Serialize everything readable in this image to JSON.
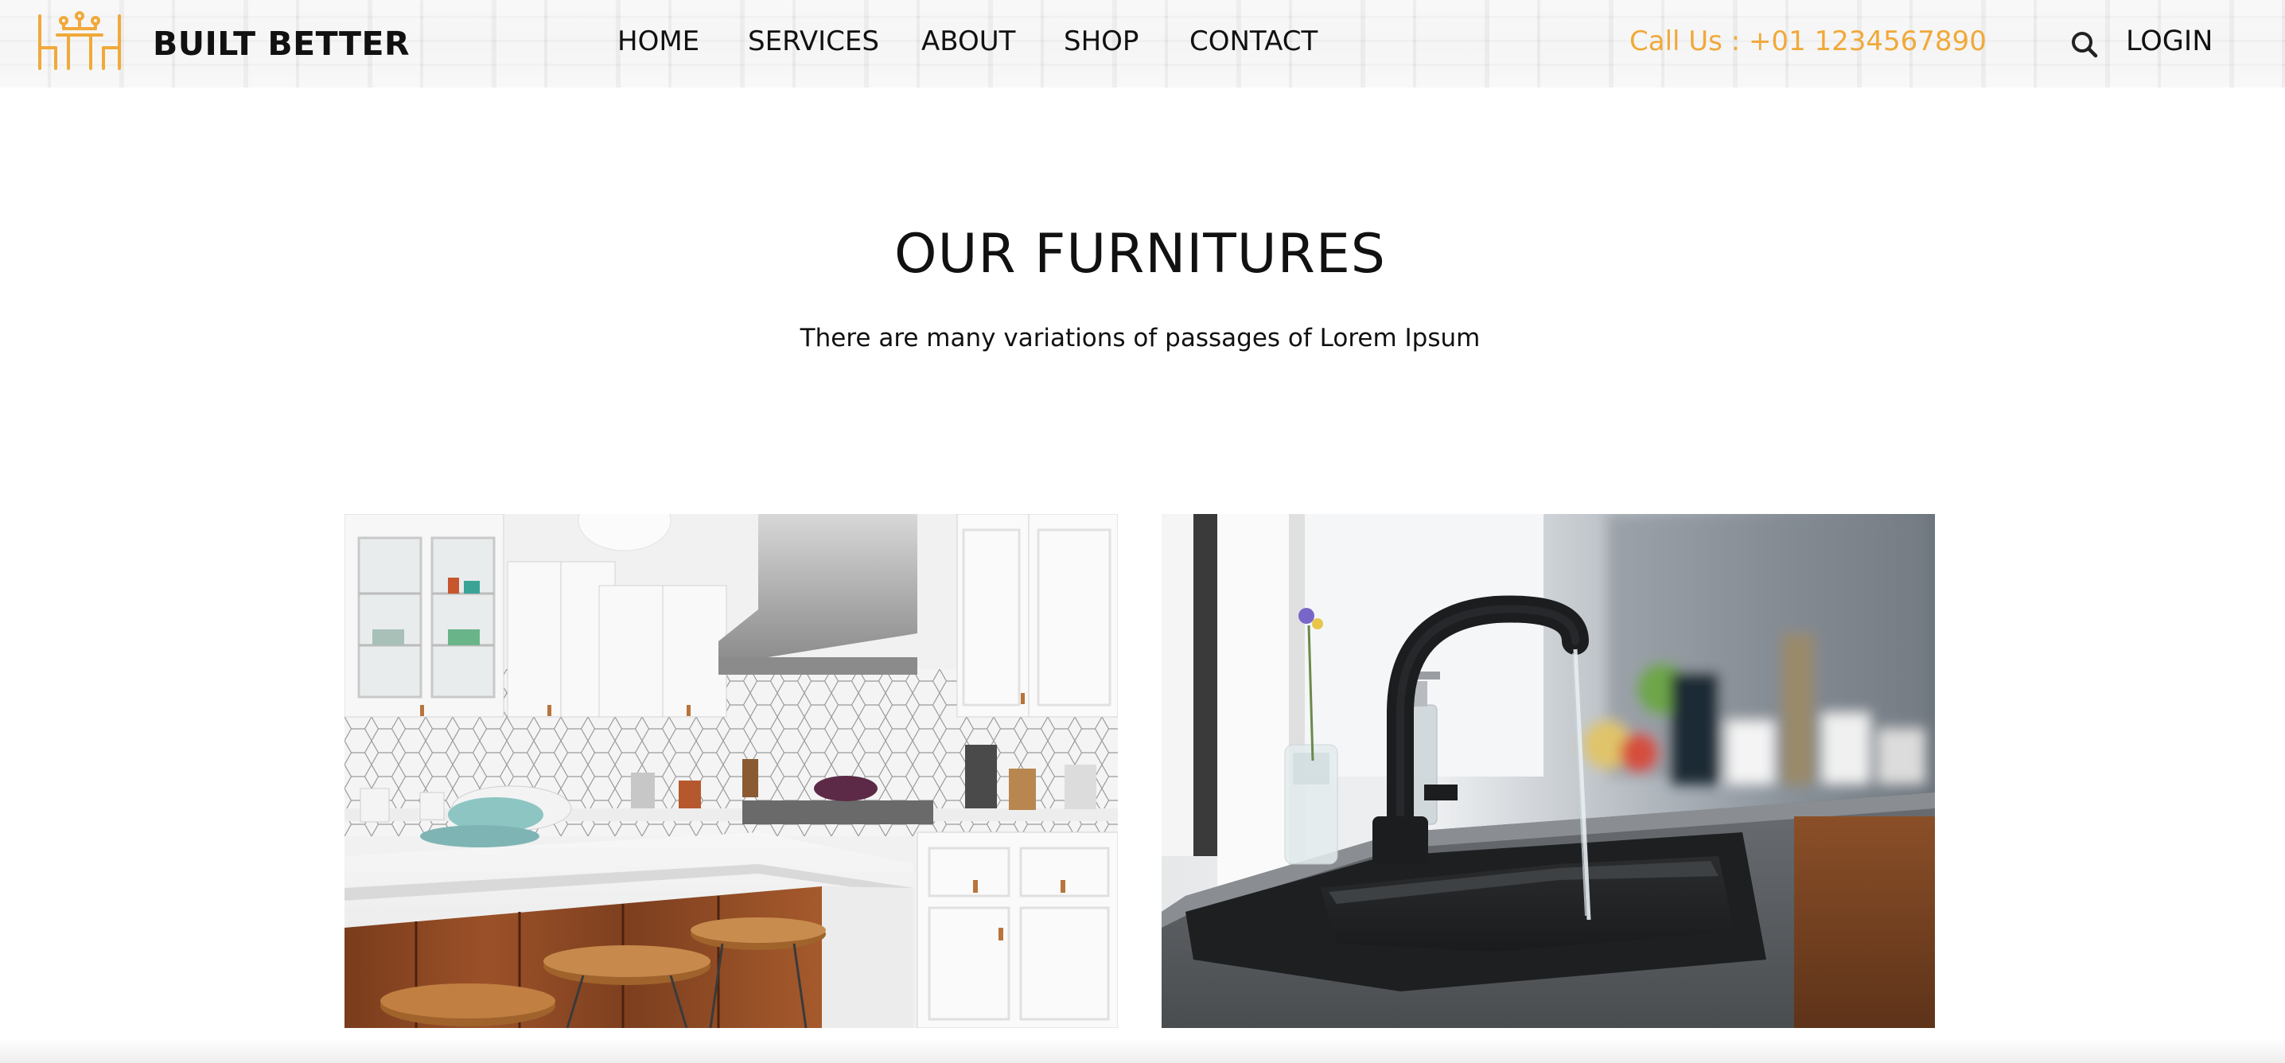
{
  "header": {
    "brand": "BUILT BETTER",
    "logo_icon": "furniture-table-chairs-icon",
    "nav": [
      {
        "label": "HOME"
      },
      {
        "label": "SERVICES"
      },
      {
        "label": "ABOUT"
      },
      {
        "label": "SHOP"
      },
      {
        "label": "CONTACT"
      }
    ],
    "phone": "Call Us : +01 1234567890",
    "search_icon": "search-icon",
    "login_label": "LOGIN"
  },
  "main": {
    "title": "OUR FURNITURES",
    "subtitle": "There are many variations of passages of Lorem Ipsum"
  },
  "gallery": {
    "images": [
      {
        "subject": "white-kitchen-island-photo"
      },
      {
        "subject": "black-sink-faucet-photo"
      }
    ]
  },
  "colors": {
    "accent": "#f0a93a",
    "text": "#111111",
    "background": "#ffffff"
  }
}
